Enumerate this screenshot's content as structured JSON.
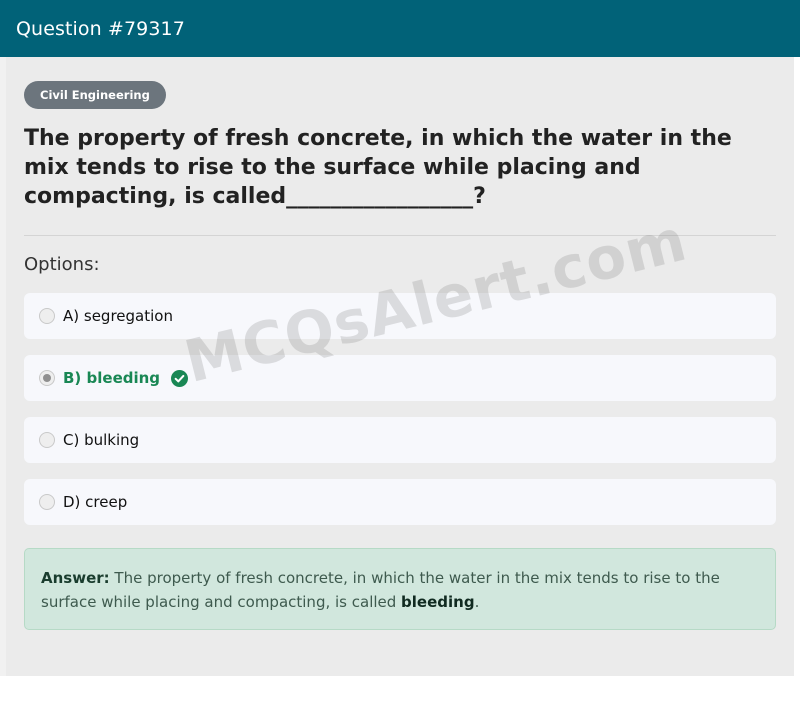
{
  "header": {
    "title": "Question #79317"
  },
  "category": "Civil Engineering",
  "question": "The property of fresh concrete, in which the water in the mix tends to rise to the surface while placing and compacting, is called_________________?",
  "options_label": "Options:",
  "options": [
    {
      "label": "A) segregation",
      "selected": false,
      "correct": false
    },
    {
      "label": "B) bleeding",
      "selected": true,
      "correct": true
    },
    {
      "label": "C) bulking",
      "selected": false,
      "correct": false
    },
    {
      "label": "D) creep",
      "selected": false,
      "correct": false
    }
  ],
  "answer": {
    "label": "Answer:",
    "text_before": " The property of fresh concrete, in which the water in the mix tends to rise to the surface while placing and compacting, is called ",
    "keyword": "bleeding",
    "text_after": "."
  },
  "watermark": "MCQsAlert.com",
  "colors": {
    "header_bg": "#016278",
    "badge_bg": "#6c757d",
    "correct": "#198754",
    "answer_bg": "#d1e7dd"
  },
  "icons": {
    "correct_marker": "check-circle-icon"
  }
}
